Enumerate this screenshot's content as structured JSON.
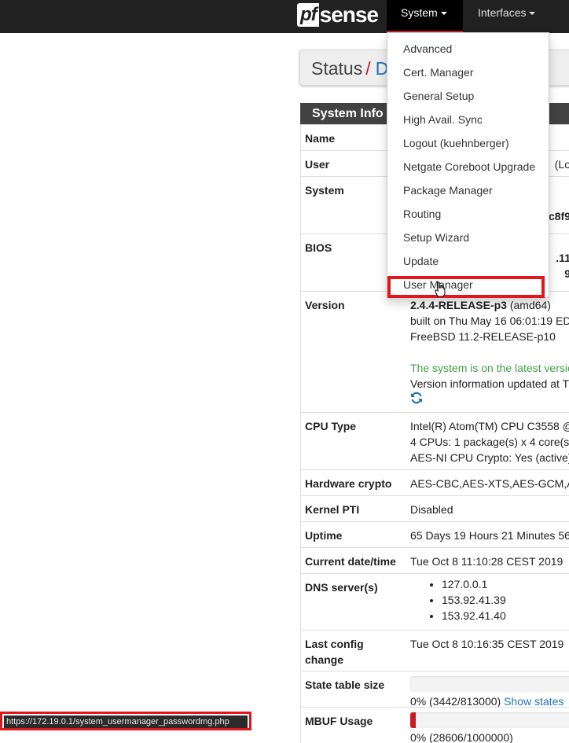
{
  "nav": {
    "logo_pf": "pf",
    "logo_sense": "sense",
    "system_label": "System",
    "interfaces_label": "Interfaces"
  },
  "breadcrumb": {
    "status": "Status",
    "separator": "/",
    "dashboard": "D"
  },
  "panel": {
    "title": "System Info"
  },
  "rows": {
    "name": {
      "label": "Name"
    },
    "user": {
      "label": "User",
      "value": "(Lo"
    },
    "system": {
      "label": "System",
      "value": "c8f9"
    },
    "bios": {
      "label": "BIOS",
      "value1": ".11",
      "value2": "9"
    },
    "version": {
      "label": "Version",
      "release": "2.4.4-RELEASE-p3",
      "arch": "(amd64)",
      "built": "built on Thu May 16 06:01:19 EDT",
      "freebsd": "FreeBSD 11.2-RELEASE-p10",
      "latest": "The system is on the latest versio",
      "updated": "Version information updated at T"
    },
    "cpu": {
      "label": "CPU Type",
      "line1": "Intel(R) Atom(TM) CPU C3558 @",
      "line2": "4 CPUs: 1 package(s) x 4 core(s)",
      "line3": "AES-NI CPU Crypto: Yes (active)"
    },
    "hwcrypto": {
      "label": "Hardware crypto",
      "value": "AES-CBC,AES-XTS,AES-GCM,AES"
    },
    "pti": {
      "label": "Kernel PTI",
      "value": "Disabled"
    },
    "uptime": {
      "label": "Uptime",
      "value": "65 Days 19 Hours 21 Minutes 56"
    },
    "datetime": {
      "label": "Current date/time",
      "value": "Tue Oct 8 11:10:28 CEST 2019"
    },
    "dns": {
      "label": "DNS server(s)",
      "servers": [
        "127.0.0.1",
        "153.92.41.39",
        "153.92.41.40"
      ]
    },
    "lastconfig": {
      "label_line1": "Last config",
      "label_line2": "change",
      "value": "Tue Oct 8 10:16:35 CEST 2019"
    },
    "state": {
      "label": "State table size",
      "value": "0% (3442/813000)",
      "link": "Show states",
      "fill": 0.0
    },
    "mbuf": {
      "label": "MBUF Usage",
      "value": "0% (28606/1000000)",
      "fill": 0.03
    }
  },
  "menu": {
    "items": [
      "Advanced",
      "Cert. Manager",
      "General Setup",
      "High Avail. Sync",
      "Logout (kuehnberger)",
      "Netgate Coreboot Upgrade",
      "Package Manager",
      "Routing",
      "Setup Wizard",
      "Update",
      "User Manager"
    ]
  },
  "statusbar": {
    "url": "https://172.19.0.1/system_usermanager_passwordmg.php"
  },
  "colors": {
    "navbar": "#212121",
    "accent_red": "#c71c22",
    "highlight_red": "#e3161e",
    "link_blue": "#1e73be",
    "ok_green": "#43a047"
  }
}
